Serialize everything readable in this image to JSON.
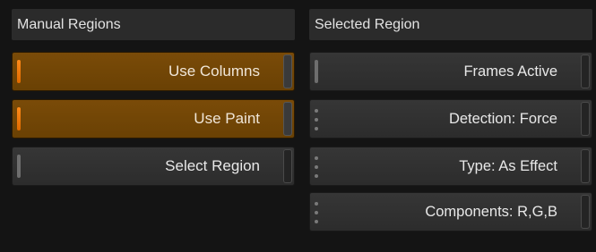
{
  "manual_regions": {
    "title": "Manual Regions",
    "buttons": [
      {
        "label": "Use Columns",
        "active": true,
        "indicator": "toggle-pill"
      },
      {
        "label": "Use Paint",
        "active": true,
        "indicator": "toggle-pill"
      },
      {
        "label": "Select Region",
        "active": false,
        "indicator": "toggle-pill"
      }
    ]
  },
  "selected_region": {
    "title": "Selected Region",
    "buttons": [
      {
        "label": "Frames Active",
        "indicator": "toggle-pill"
      },
      {
        "label": "Detection: Force",
        "indicator": "cycle-dots"
      },
      {
        "label": "Type: As Effect",
        "indicator": "cycle-dots"
      },
      {
        "label": "Components: R,G,B",
        "indicator": "cycle-dots"
      }
    ]
  },
  "colors": {
    "background": "#141414",
    "header": "#2b2b2b",
    "button": "#313131",
    "active_button": "#724606",
    "active_indicator": "#f57c0c"
  }
}
